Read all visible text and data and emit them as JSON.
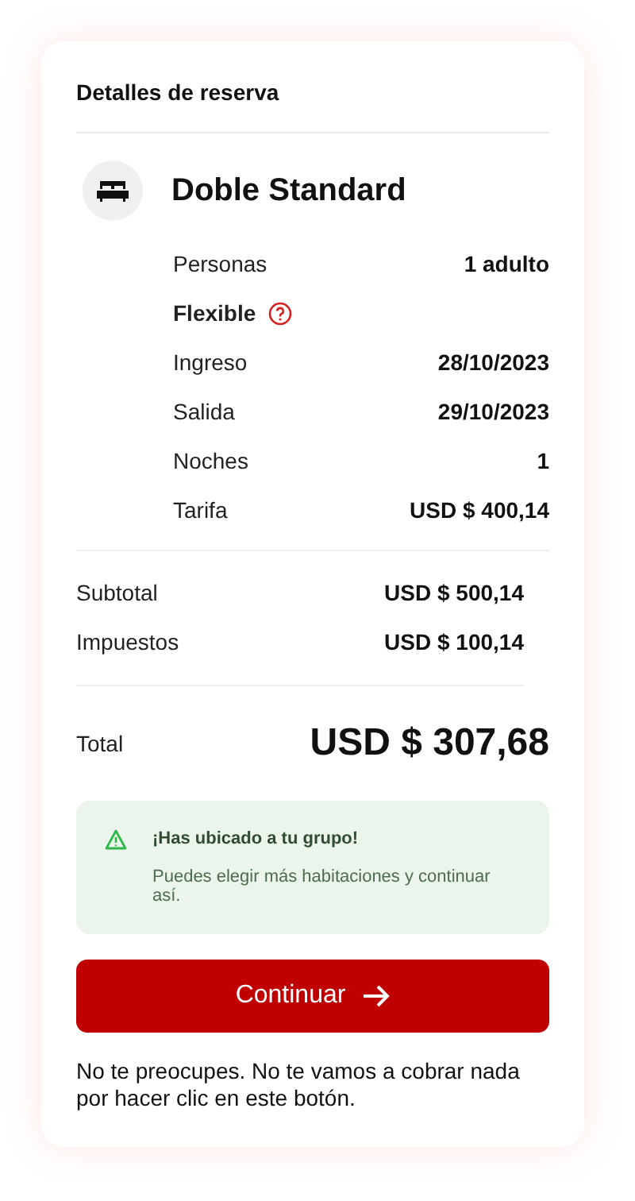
{
  "title": "Detalles de reserva",
  "room": {
    "name": "Doble Standard"
  },
  "details": [
    {
      "kind": "pair",
      "label": "Personas",
      "value": "1 adulto"
    },
    {
      "kind": "policy",
      "label": "Flexible"
    },
    {
      "kind": "pair",
      "label": "Ingreso",
      "value": "28/10/2023"
    },
    {
      "kind": "pair",
      "label": "Salida",
      "value": "29/10/2023"
    },
    {
      "kind": "pair",
      "label": "Noches",
      "value": "1"
    },
    {
      "kind": "pair",
      "label": "Tarifa",
      "value": "USD $ 400,14"
    }
  ],
  "summary": [
    {
      "label": "Subtotal",
      "value": "USD $ 500,14"
    },
    {
      "label": "Impuestos",
      "value": "USD $ 100,14"
    }
  ],
  "total": {
    "label": "Total",
    "value": "USD $ 307,68"
  },
  "notice": {
    "title": "¡Has ubicado a tu grupo!",
    "text": "Puedes elegir más habitaciones y continuar así."
  },
  "button": {
    "label": "Continuar"
  },
  "footnote": "No te preocupes. No te vamos a cobrar nada por hacer clic en este botón."
}
